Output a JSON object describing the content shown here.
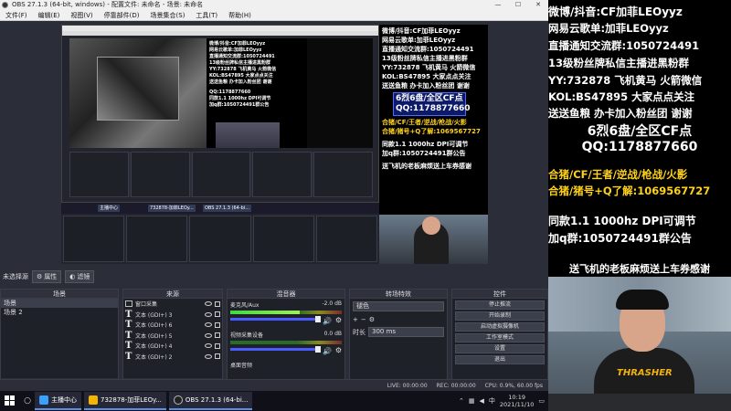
{
  "window": {
    "title": "OBS 27.1.3 (64-bit, windows) - 配置文件: 未命名 - 场景: 未命名",
    "controls": [
      "—",
      "☐",
      "✕"
    ]
  },
  "menu": [
    "文件(F)",
    "编辑(E)",
    "视图(V)",
    "停靠部件(D)",
    "场景集合(S)",
    "工具(T)",
    "帮助(H)"
  ],
  "nested": {
    "mid_lines": [
      "微博/抖音:CF加菲LEOyyz",
      "网易云歌单:加菲LEOyyz",
      "直播通知交流群:1050724491",
      "13级粉丝牌私信主播进黑粉群",
      "YY:732878 飞机黄马 火箭微信",
      "KOL:BS47895 大家点点关注",
      "送送鱼粮 办卡加入粉丝团 谢谢"
    ],
    "mid_qq": "QQ:1178877660",
    "mid_extra": [
      "同款1.1 1000hz DPI可调节",
      "加q群:1050724491群公告"
    ],
    "right_lines": [
      "微博/抖音:CF加菲LEOyyz",
      "网易云歌单:加菲LEOyyz",
      "直播通知交流群:1050724491",
      "13级粉丝牌私信主播进黑粉群",
      "YY:732878 飞机黄马 火箭微信",
      "KOL:BS47895 大家点点关注",
      "送送鱼粮 办卡加入粉丝团 谢谢"
    ],
    "right_hl1": "6烈6盘/全区CF点",
    "right_hl2": "QQ:1178877660",
    "right_yel": [
      "合猪/CF/王者/逆战/枪战/火影",
      "合猪/猪号+Q了解:1069567727"
    ],
    "right_dpi": [
      "同款1.1 1000hz DPI可调节",
      "加q群:1050724491群公告"
    ],
    "right_plane": "送飞机的老板麻烦送上车券感谢",
    "task_items": [
      "主播中心",
      "732878-加菲LEOy...",
      "OBS 27.1.3 (64-bi..."
    ]
  },
  "filter": {
    "label": "未选择源",
    "props_label": "属性",
    "filters_label": "滤镜"
  },
  "scenes": {
    "header": "场景",
    "items": [
      "场景",
      "场景 2"
    ]
  },
  "sources": {
    "header": "来源",
    "items": [
      {
        "type": "window",
        "label": "窗口采集"
      },
      {
        "type": "text",
        "label": "文本 (GDI+) 3"
      },
      {
        "type": "text",
        "label": "文本 (GDI+) 6"
      },
      {
        "type": "text",
        "label": "文本 (GDI+) 5"
      },
      {
        "type": "text",
        "label": "文本 (GDI+) 4"
      },
      {
        "type": "text",
        "label": "文本 (GDI+) 2"
      }
    ]
  },
  "mixer": {
    "header": "混音器",
    "channels": [
      {
        "name": "麦克风/Aux",
        "db": "-2.0 dB",
        "level": 0.62,
        "volume": 0.78
      },
      {
        "name": "视频采集设备",
        "db": "0.0 dB",
        "level": 0.0,
        "volume": 0.78
      },
      {
        "name": "桌面音频",
        "db": "",
        "level": 0.0,
        "volume": 0.78
      }
    ]
  },
  "transitions": {
    "header": "转场特效",
    "selected": "褪色",
    "duration_label": "时长",
    "duration_value": "300 ms"
  },
  "controls": {
    "header": "控件",
    "buttons": [
      "停止推流",
      "开始录制",
      "启动虚拟摄像机",
      "工作室模式",
      "设置",
      "退出"
    ]
  },
  "status": {
    "live": "LIVE: 00:00:00",
    "rec": "REC: 00:00:00",
    "cpu": "CPU: 0.9%, 60.00 fps"
  },
  "overlay": {
    "lines": [
      "微博/抖音:CF加菲LEOyyz",
      "网易云歌单:加菲LEOyyz",
      "直播通知交流群:1050724491",
      "13级粉丝牌私信主播进黑粉群",
      "YY:732878 飞机黄马 火箭微信",
      "KOL:BS47895 大家点点关注",
      "送送鱼粮 办卡加入粉丝团 谢谢"
    ],
    "highlight1": "6烈6盘/全区CF点",
    "highlight2": "QQ:1178877660",
    "yellow1": "合猪/CF/王者/逆战/枪战/火影",
    "yellow2": "合猪/猪号+Q了解:1069567727",
    "dpi1": "同款1.1 1000hz DPI可调节",
    "dpi2": "加q群:1050724491群公告",
    "plane": "送飞机的老板麻烦送上车券感谢",
    "cam_logo": "THRASHER"
  },
  "taskbar": {
    "items": [
      "主播中心",
      "732878-加菲LEOy...",
      "OBS 27.1.3 (64-bi..."
    ],
    "time": "10:19",
    "date": "2021/11/10"
  },
  "colors": {
    "obs_bg": "#2b2e38",
    "highlight_bg": "#0d1a6a",
    "yellow": "#ffd21a",
    "accent": "#4a5cff"
  }
}
